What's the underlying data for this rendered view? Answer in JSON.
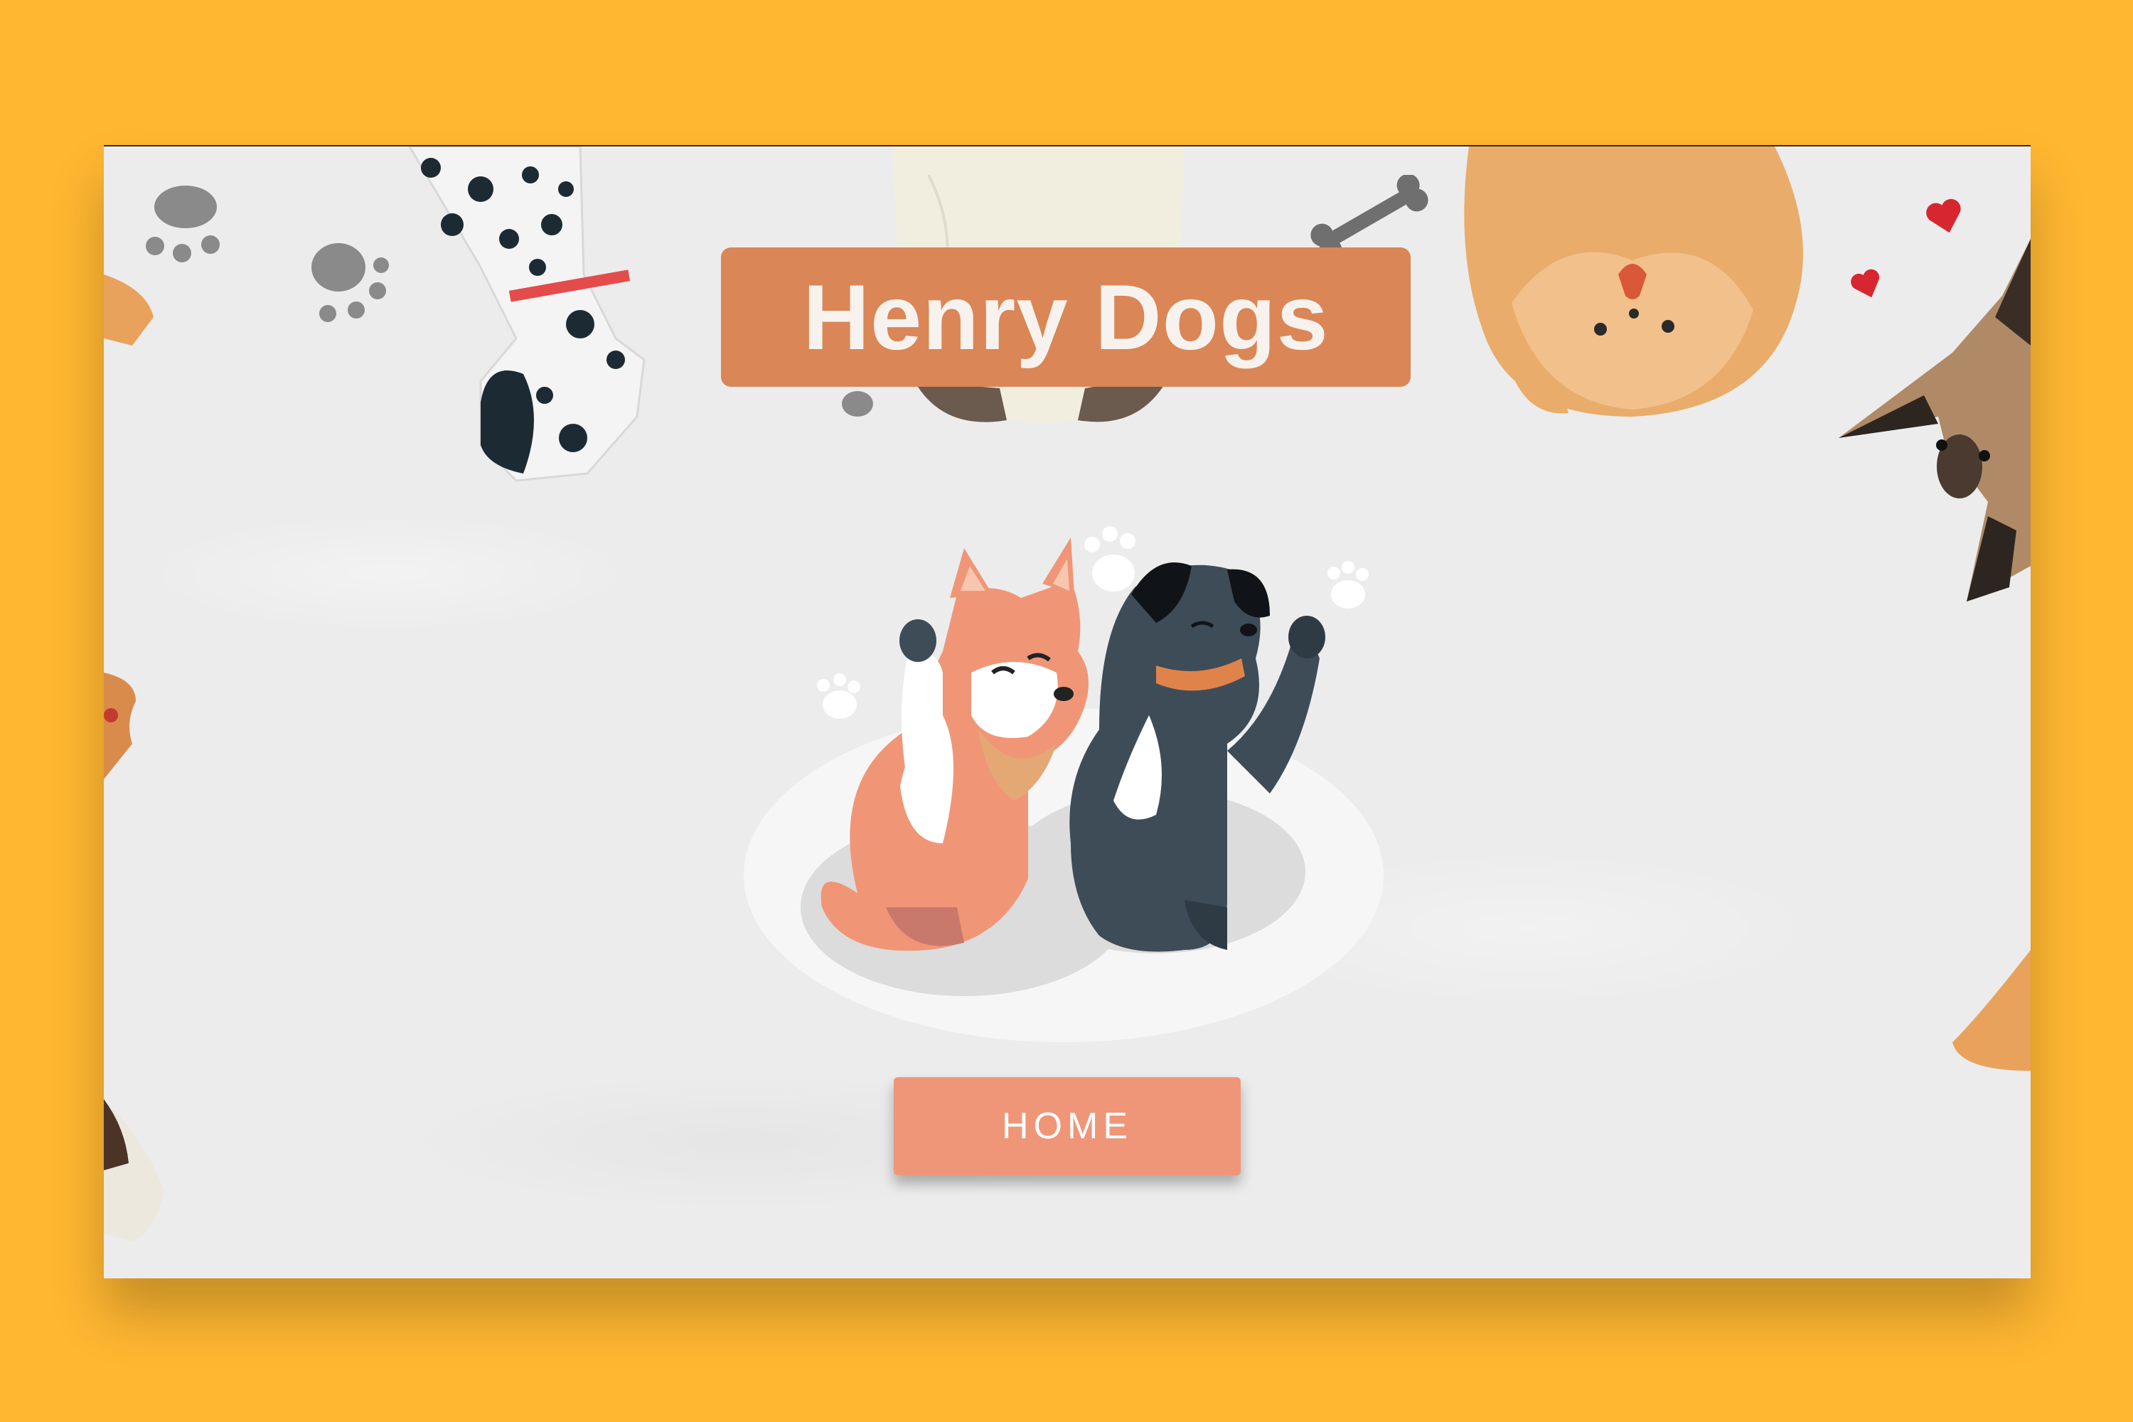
{
  "page": {
    "background_color": "#FFB731",
    "card_color": "#ECECEC"
  },
  "header": {
    "title": "Henry Dogs",
    "title_bg": "#DA8656"
  },
  "actions": {
    "home_label": "HOME",
    "home_bg": "#EF9679"
  },
  "decorations": {
    "icons": [
      "paw-print-icon",
      "bone-icon",
      "heart-icon",
      "dalmatian-illustration",
      "pug-illustration",
      "shiba-illustration",
      "shepherd-illustration"
    ],
    "hero": "two-dogs-waving-illustration"
  }
}
